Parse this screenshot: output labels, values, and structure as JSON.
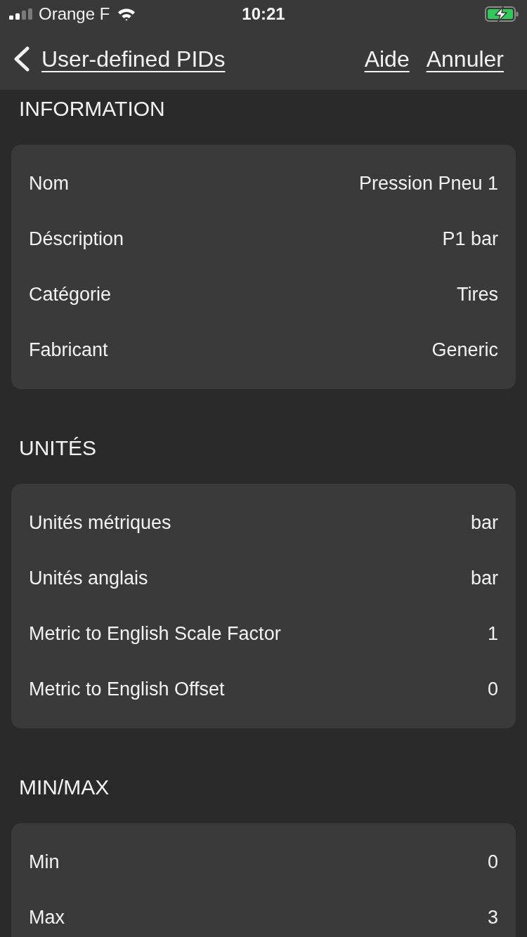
{
  "status_bar": {
    "carrier": "Orange F",
    "time": "10:21",
    "charging": true
  },
  "nav_bar": {
    "back_label": "User-defined PIDs",
    "actions": [
      "Aide",
      "Annuler"
    ]
  },
  "sections": [
    {
      "title": "INFORMATION",
      "rows": [
        {
          "label": "Nom",
          "value": "Pression Pneu 1"
        },
        {
          "label": "Déscription",
          "value": "P1 bar"
        },
        {
          "label": "Catégorie",
          "value": "Tires"
        },
        {
          "label": "Fabricant",
          "value": "Generic"
        }
      ]
    },
    {
      "title": "UNITÉS",
      "rows": [
        {
          "label": "Unités métriques",
          "value": "bar"
        },
        {
          "label": "Unités anglais",
          "value": "bar"
        },
        {
          "label": "Metric to English Scale Factor",
          "value": "1"
        },
        {
          "label": "Metric to English Offset",
          "value": "0"
        }
      ]
    },
    {
      "title": "MIN/MAX",
      "rows": [
        {
          "label": "Min",
          "value": "0"
        },
        {
          "label": "Max",
          "value": "3"
        }
      ]
    }
  ]
}
